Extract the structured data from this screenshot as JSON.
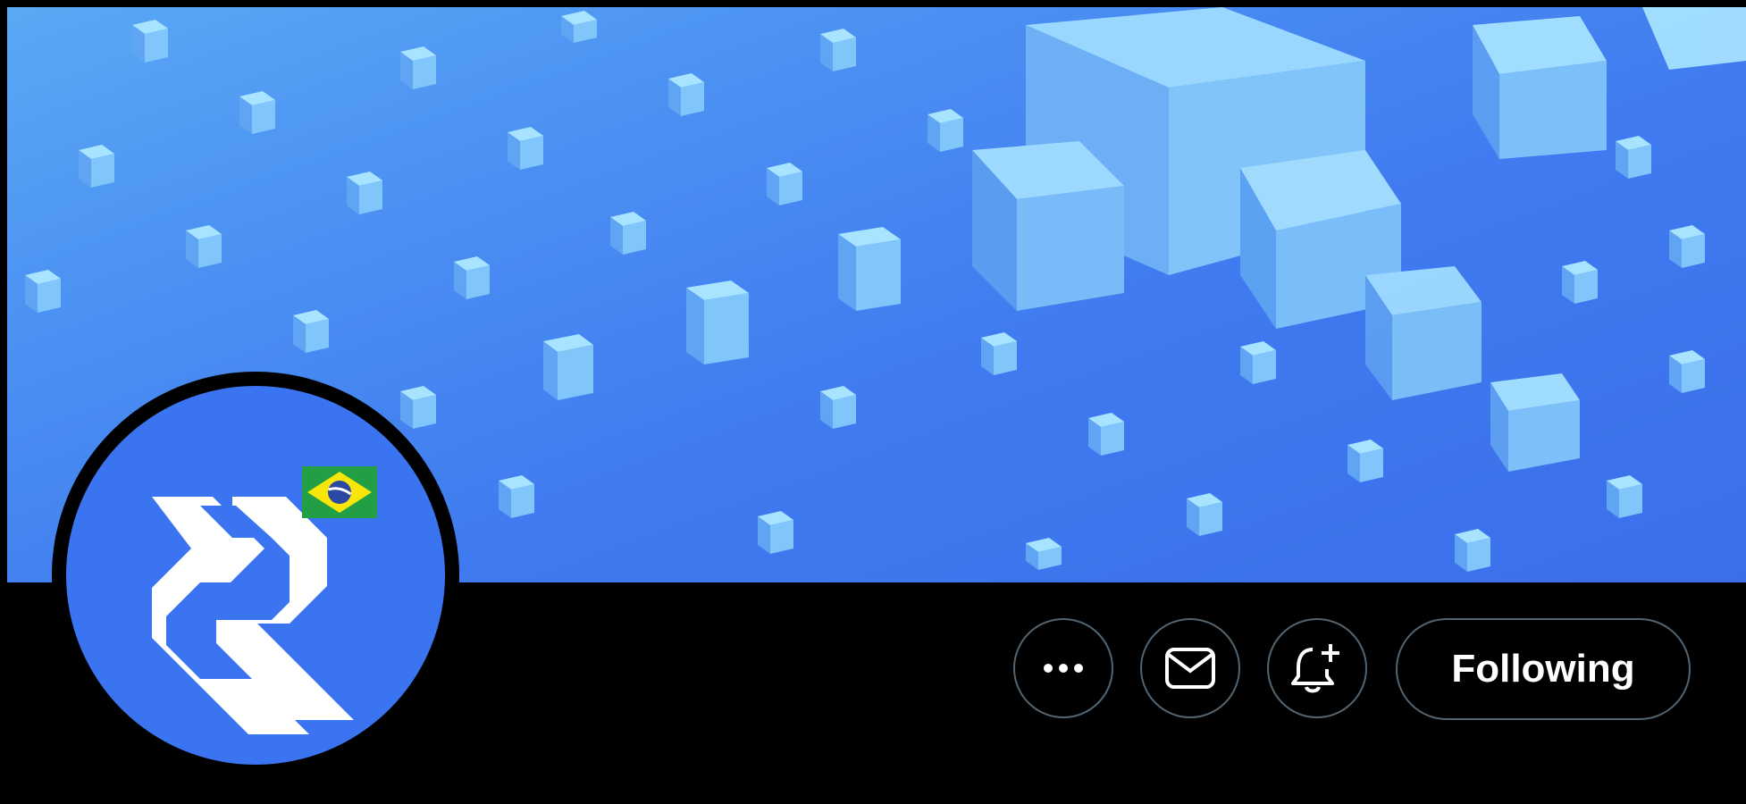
{
  "profile": {
    "avatar_badge": "brazil-flag",
    "logo": "decred-logo"
  },
  "actions": {
    "more_icon": "more-horizontal-icon",
    "message_icon": "mail-icon",
    "notify_icon": "bell-plus-icon",
    "follow_label": "Following"
  },
  "colors": {
    "background": "#000000",
    "banner_blue": "#3f7af0",
    "avatar_blue": "#3b74f0",
    "button_border": "#536471",
    "text": "#ffffff"
  }
}
